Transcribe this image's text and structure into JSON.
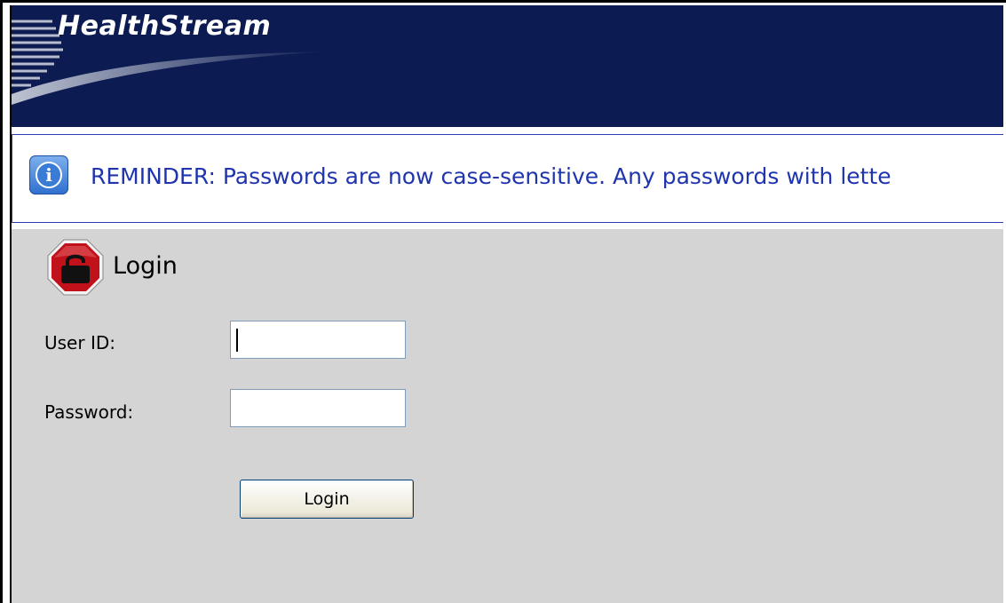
{
  "brand": {
    "name": "HealthStream"
  },
  "reminder": {
    "icon": "info-icon",
    "text": "REMINDER: Passwords are now case-sensitive. Any passwords with lette"
  },
  "login": {
    "icon": "padlock-stop-icon",
    "title": "Login",
    "user_id_label": "User ID:",
    "user_id_value": "",
    "password_label": "Password:",
    "password_value": "",
    "submit_label": "Login"
  },
  "colors": {
    "header_bg": "#0c1c53",
    "panel_bg": "#d4d4d4",
    "reminder_text": "#1f35ad",
    "reminder_border": "#2a3fb3",
    "stop_red": "#c1121c"
  }
}
